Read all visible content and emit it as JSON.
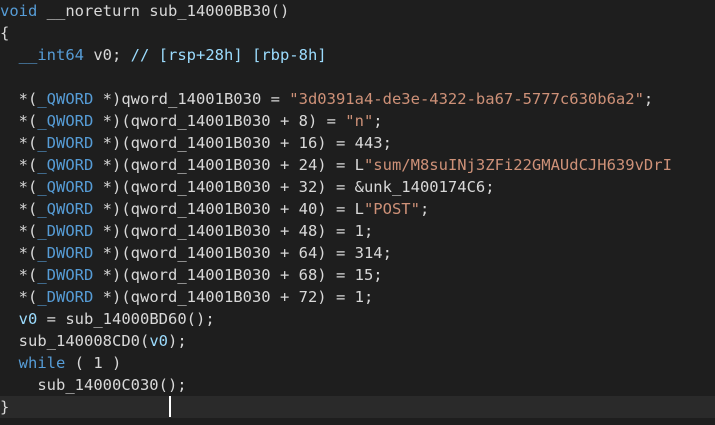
{
  "lines": [
    [
      {
        "text": "void",
        "kind": "keyword"
      },
      {
        "text": " __noreturn sub_14000BB30()",
        "kind": "plain"
      }
    ],
    [
      {
        "text": "{",
        "kind": "plain"
      }
    ],
    [
      {
        "text": "  ",
        "kind": "plain"
      },
      {
        "text": "__int64",
        "kind": "keyword"
      },
      {
        "text": " v0; ",
        "kind": "plain"
      },
      {
        "text": "// [rsp+28h] [rbp-8h]",
        "kind": "comment"
      }
    ],
    [
      {
        "text": "",
        "kind": "plain"
      }
    ],
    [
      {
        "text": "  *(",
        "kind": "plain"
      },
      {
        "text": "_QWORD",
        "kind": "keyword"
      },
      {
        "text": " *)qword_14001B030 = ",
        "kind": "plain"
      },
      {
        "text": "\"3d0391a4-de3e-4322-ba67-5777c630b6a2\"",
        "kind": "string"
      },
      {
        "text": ";",
        "kind": "plain"
      }
    ],
    [
      {
        "text": "  *(",
        "kind": "plain"
      },
      {
        "text": "_QWORD",
        "kind": "keyword"
      },
      {
        "text": " *)(qword_14001B030 + 8) = ",
        "kind": "plain"
      },
      {
        "text": "\"n\"",
        "kind": "string"
      },
      {
        "text": ";",
        "kind": "plain"
      }
    ],
    [
      {
        "text": "  *(",
        "kind": "plain"
      },
      {
        "text": "_DWORD",
        "kind": "keyword"
      },
      {
        "text": " *)(qword_14001B030 + 16) = 443;",
        "kind": "plain"
      }
    ],
    [
      {
        "text": "  *(",
        "kind": "plain"
      },
      {
        "text": "_QWORD",
        "kind": "keyword"
      },
      {
        "text": " *)(qword_14001B030 + 24) = L",
        "kind": "plain"
      },
      {
        "text": "\"sum/M8suINj3ZFi22GMAUdCJH639vDrI",
        "kind": "string"
      }
    ],
    [
      {
        "text": "  *(",
        "kind": "plain"
      },
      {
        "text": "_QWORD",
        "kind": "keyword"
      },
      {
        "text": " *)(qword_14001B030 + 32) = &unk_1400174C6;",
        "kind": "plain"
      }
    ],
    [
      {
        "text": "  *(",
        "kind": "plain"
      },
      {
        "text": "_QWORD",
        "kind": "keyword"
      },
      {
        "text": " *)(qword_14001B030 + 40) = L",
        "kind": "plain"
      },
      {
        "text": "\"POST\"",
        "kind": "string"
      },
      {
        "text": ";",
        "kind": "plain"
      }
    ],
    [
      {
        "text": "  *(",
        "kind": "plain"
      },
      {
        "text": "_DWORD",
        "kind": "keyword"
      },
      {
        "text": " *)(qword_14001B030 + 48) = 1;",
        "kind": "plain"
      }
    ],
    [
      {
        "text": "  *(",
        "kind": "plain"
      },
      {
        "text": "_DWORD",
        "kind": "keyword"
      },
      {
        "text": " *)(qword_14001B030 + 64) = 314;",
        "kind": "plain"
      }
    ],
    [
      {
        "text": "  *(",
        "kind": "plain"
      },
      {
        "text": "_DWORD",
        "kind": "keyword"
      },
      {
        "text": " *)(qword_14001B030 + 68) = 15;",
        "kind": "plain"
      }
    ],
    [
      {
        "text": "  *(",
        "kind": "plain"
      },
      {
        "text": "_DWORD",
        "kind": "keyword"
      },
      {
        "text": " *)(qword_14001B030 + 72) = 1;",
        "kind": "plain"
      }
    ],
    [
      {
        "text": "  ",
        "kind": "plain"
      },
      {
        "text": "v0",
        "kind": "argvar"
      },
      {
        "text": " = sub_14000BD60();",
        "kind": "plain"
      }
    ],
    [
      {
        "text": "  sub_140008CD0(",
        "kind": "plain"
      },
      {
        "text": "v0",
        "kind": "argvar"
      },
      {
        "text": ");",
        "kind": "plain"
      }
    ],
    [
      {
        "text": "  ",
        "kind": "plain"
      },
      {
        "text": "while",
        "kind": "keyword"
      },
      {
        "text": " ( 1 )",
        "kind": "plain"
      }
    ],
    [
      {
        "text": "    sub_14000C030();",
        "kind": "plain"
      }
    ],
    [
      {
        "text": "}",
        "kind": "plain"
      }
    ]
  ],
  "current_line_index": 18,
  "colors": {
    "background": "#1e1e1e",
    "current_line": "#2a2a2a",
    "keyword": "#569cd6",
    "string": "#ce9178",
    "comment": "#9cdcfe",
    "variable": "#9cdcfe",
    "text": "#d8d8d8",
    "cursor": "#ffffff"
  }
}
